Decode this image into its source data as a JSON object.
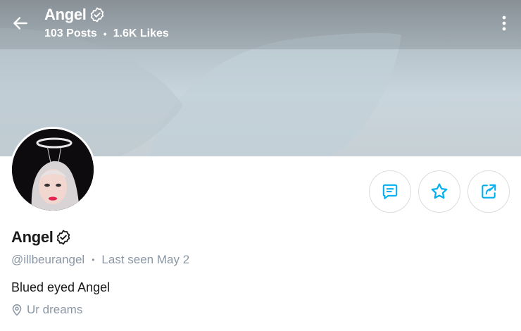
{
  "header": {
    "name": "Angel",
    "posts": "103 Posts",
    "separator": "•",
    "likes": "1.6K Likes"
  },
  "profile": {
    "name": "Angel",
    "handle": "@illbeurangel",
    "separator": "•",
    "last_seen": "Last seen May 2",
    "bio": "Blued eyed Angel",
    "location": "Ur dreams"
  },
  "actions": [
    {
      "icon": "message-icon"
    },
    {
      "icon": "star-icon"
    },
    {
      "icon": "share-icon"
    }
  ],
  "colors": {
    "accent": "#00aff0",
    "muted_text": "#8a96a3",
    "button_border": "#d9dde0"
  }
}
